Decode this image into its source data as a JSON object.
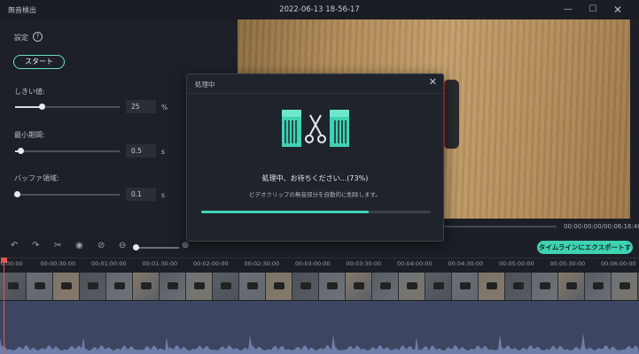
{
  "window": {
    "app_title": "無音検出",
    "title": "2022-06-13 18-56-17",
    "min_icon": "minimize-icon",
    "max_icon": "maximize-icon",
    "close_icon": "close-icon"
  },
  "settings": {
    "heading": "設定",
    "help_icon": "question-icon",
    "start_label": "スタート",
    "threshold": {
      "label": "しきい値:",
      "value": "25",
      "unit": "%",
      "level": 0.25
    },
    "min_duration": {
      "label": "最小期間:",
      "value": "0.5",
      "unit": "s",
      "level": 0.05
    },
    "buffer": {
      "label": "バッファ領域:",
      "value": "0.1",
      "unit": "s",
      "level": 0.02
    }
  },
  "preview": {
    "timecode": "00:00:00:00/00:06:16:40",
    "progress": 0
  },
  "toolbar": {
    "export_label": "タイムラインにエクスポートする",
    "icons": [
      "undo-icon",
      "redo-icon",
      "scissors-icon",
      "eye-icon",
      "eye-off-icon",
      "zoom-out-icon",
      "zoom-in-icon"
    ]
  },
  "ruler": {
    "ticks": [
      "00:00:00:00",
      "00:00:30:00",
      "00:01:00:00",
      "00:01:30:00",
      "00:02:00:00",
      "00:02:30:00",
      "00:03:00:00",
      "00:03:30:00",
      "00:04:00:00",
      "00:04:30:00",
      "00:05:00:00",
      "00:05:30:00",
      "00:06:00:00"
    ]
  },
  "modal": {
    "title": "処理中",
    "message": "処理中、お待ちください...(73%)",
    "subtitle": "ビデオクリップの無音部分を自動的に削除します。",
    "progress": 0.73,
    "icon": "scissors-cutting-icon"
  },
  "colors": {
    "accent": "#3fd3b3",
    "playhead": "#e35656"
  }
}
